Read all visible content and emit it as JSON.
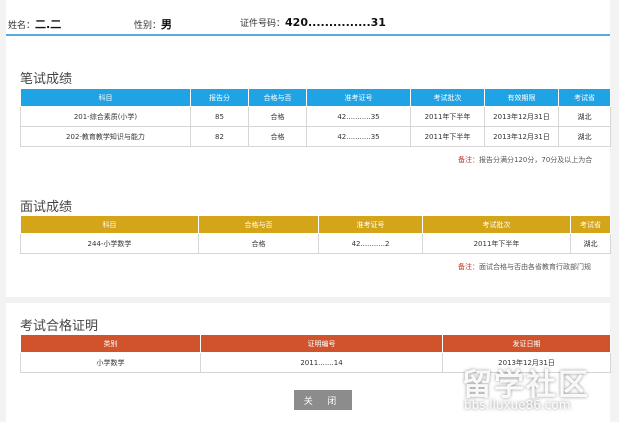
{
  "header": {
    "name_label": "姓名：",
    "name_value": "二.二",
    "gender_label": "性别：",
    "gender_value": "男",
    "id_label": "证件号码：",
    "id_value": "420...............31"
  },
  "written": {
    "title": "笔试成绩",
    "columns": [
      "科目",
      "报告分",
      "合格与否",
      "准考证号",
      "考试批次",
      "有效期限",
      "考试省"
    ],
    "rows": [
      [
        "201-综合素质(小学)",
        "85",
        "合格",
        "42...........35",
        "2011年下半年",
        "2013年12月31日",
        "湖北"
      ],
      [
        "202-教育教学知识与能力",
        "82",
        "合格",
        "42...........35",
        "2011年下半年",
        "2013年12月31日",
        "湖北"
      ]
    ],
    "note_label": "备注：",
    "note_text": "报告分满分120分，70分及以上为合"
  },
  "interview": {
    "title": "面试成绩",
    "columns": [
      "科目",
      "合格与否",
      "准考证号",
      "考试批次",
      "考试省"
    ],
    "rows": [
      [
        "244-小学数学",
        "合格",
        "42...........2",
        "2011年下半年",
        "湖北"
      ]
    ],
    "note_label": "备注：",
    "note_text": "面试合格与否由各省教育行政部门规"
  },
  "certificate": {
    "title": "考试合格证明",
    "columns": [
      "类别",
      "证明编号",
      "发证日期"
    ],
    "rows": [
      [
        "小学数学",
        "2011.......14",
        "2013年12月31日"
      ]
    ]
  },
  "close_label": "关 闭",
  "watermark": {
    "text": "留学社区",
    "url": "bbs.liuxue86.com"
  }
}
